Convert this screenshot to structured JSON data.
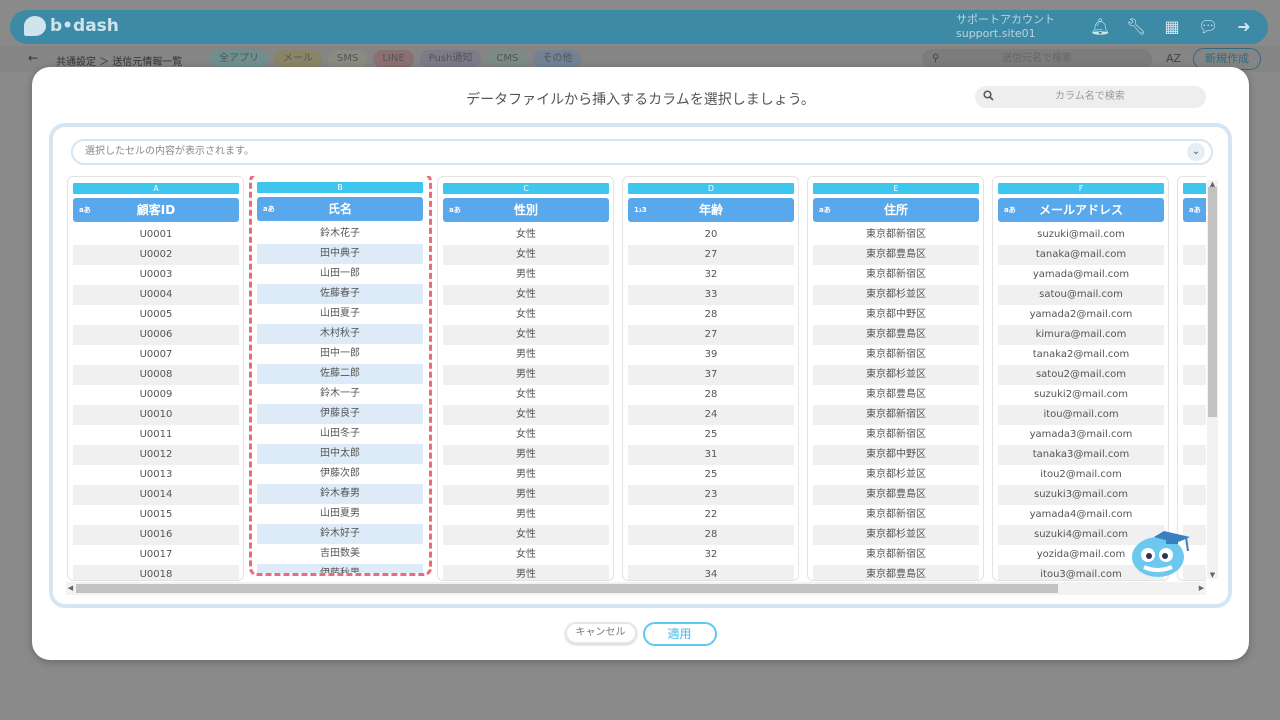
{
  "app": {
    "logo_text": "b•dash",
    "account_name": "サポートアカウント",
    "account_id": "support.site01",
    "breadcrumb": "共通設定 ＞ 送信元情報一覧",
    "filters": [
      "全アプリ",
      "メール",
      "SMS",
      "LINE",
      "Push通知",
      "CMS",
      "その他"
    ],
    "search_placeholder": "送信元名で検索",
    "sort_label": "AZ",
    "new_button": "新規作成"
  },
  "modal": {
    "title": "データファイルから挿入するカラムを選択しましょう。",
    "column_search_placeholder": "カラム名で検索",
    "cell_viewer_placeholder": "選択したセルの内容が表示されます。",
    "cancel_label": "キャンセル",
    "apply_label": "適用"
  },
  "columns": [
    {
      "letter": "A",
      "type": "aあ",
      "name": "顧客ID",
      "selected": false,
      "values": [
        "U0001",
        "U0002",
        "U0003",
        "U0004",
        "U0005",
        "U0006",
        "U0007",
        "U0008",
        "U0009",
        "U0010",
        "U0011",
        "U0012",
        "U0013",
        "U0014",
        "U0015",
        "U0016",
        "U0017",
        "U0018"
      ]
    },
    {
      "letter": "B",
      "type": "aあ",
      "name": "氏名",
      "selected": true,
      "values": [
        "鈴木花子",
        "田中典子",
        "山田一郎",
        "佐藤春子",
        "山田夏子",
        "木村秋子",
        "田中一郎",
        "佐藤二郎",
        "鈴木一子",
        "伊藤良子",
        "山田冬子",
        "田中太郎",
        "伊藤次郎",
        "鈴木春男",
        "山田夏男",
        "鈴木好子",
        "吉田数美",
        "伊藤秋男"
      ]
    },
    {
      "letter": "C",
      "type": "aあ",
      "name": "性別",
      "selected": false,
      "values": [
        "女性",
        "女性",
        "男性",
        "女性",
        "女性",
        "女性",
        "男性",
        "男性",
        "女性",
        "女性",
        "女性",
        "男性",
        "男性",
        "男性",
        "男性",
        "女性",
        "女性",
        "男性"
      ]
    },
    {
      "letter": "D",
      "type": "1₂3",
      "name": "年齢",
      "selected": false,
      "values": [
        "20",
        "27",
        "32",
        "33",
        "28",
        "27",
        "39",
        "37",
        "28",
        "24",
        "25",
        "31",
        "25",
        "23",
        "22",
        "28",
        "32",
        "34"
      ]
    },
    {
      "letter": "E",
      "type": "aあ",
      "name": "住所",
      "selected": false,
      "values": [
        "東京都新宿区",
        "東京都豊島区",
        "東京都新宿区",
        "東京都杉並区",
        "東京都中野区",
        "東京都豊島区",
        "東京都新宿区",
        "東京都杉並区",
        "東京都豊島区",
        "東京都新宿区",
        "東京都新宿区",
        "東京都中野区",
        "東京都杉並区",
        "東京都豊島区",
        "東京都新宿区",
        "東京都杉並区",
        "東京都新宿区",
        "東京都豊島区"
      ]
    },
    {
      "letter": "F",
      "type": "aあ",
      "name": "メールアドレス",
      "selected": false,
      "values": [
        "suzuki@mail.com",
        "tanaka@mail.com",
        "yamada@mail.com",
        "satou@mail.com",
        "yamada2@mail.com",
        "kimura@mail.com",
        "tanaka2@mail.com",
        "satou2@mail.com",
        "suzuki2@mail.com",
        "itou@mail.com",
        "yamada3@mail.com",
        "tanaka3@mail.com",
        "itou2@mail.com",
        "suzuki3@mail.com",
        "yamada4@mail.com",
        "suzuki4@mail.com",
        "yozida@mail.com",
        "itou3@mail.com"
      ]
    },
    {
      "letter": "",
      "type": "aあ",
      "name": "",
      "selected": false,
      "values": [
        "",
        "",
        "",
        "",
        "",
        "",
        "",
        "",
        "",
        "",
        "",
        "",
        "",
        "",
        "",
        "",
        "",
        ""
      ]
    }
  ],
  "colors": {
    "column_letter_bg": "#3fc6ef",
    "column_header_bg": "#5aa8ec",
    "selection_dash": "#ec6b78",
    "apply_accent": "#5cc9ef"
  }
}
